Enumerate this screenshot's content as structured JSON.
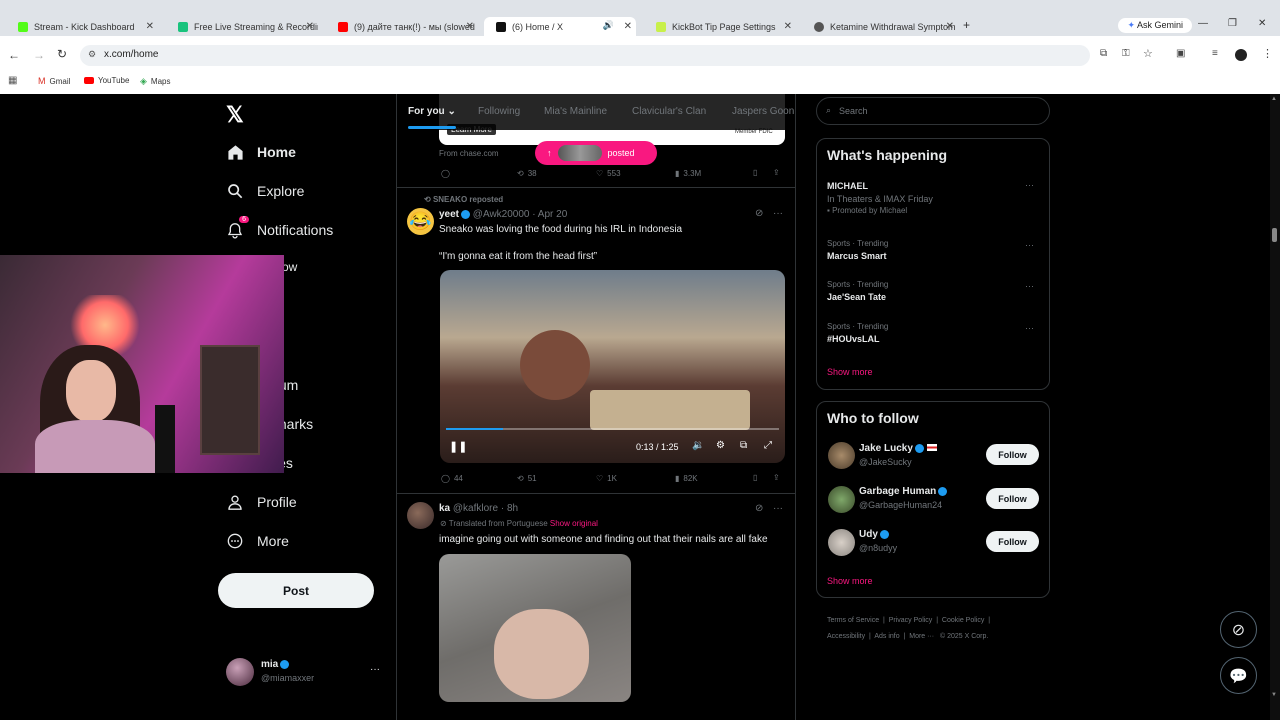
{
  "browser": {
    "tabs": [
      {
        "title": "Stream - Kick Dashboard",
        "color": "#53fc18"
      },
      {
        "title": "Free Live Streaming & Recordin",
        "color": "#19c37d"
      },
      {
        "title": "(9) дайте танк(!) - мы (slowed",
        "color": "#ff0000"
      },
      {
        "title": "(6) Home / X",
        "color": "#111111"
      },
      {
        "title": "KickBot Tip Page Settings",
        "color": "#c8f04a"
      },
      {
        "title": "Ketamine Withdrawal Symptom",
        "color": "#555555"
      }
    ],
    "new_tab": "+",
    "gemini": "Ask Gemini",
    "url": "x.com/home",
    "bookmarks": [
      "Gmail",
      "YouTube",
      "Maps"
    ]
  },
  "nav": {
    "items": [
      {
        "label": "Home",
        "icon": "home-icon"
      },
      {
        "label": "Explore",
        "icon": "search-icon"
      },
      {
        "label": "Notifications",
        "icon": "bell-icon",
        "badge": "6"
      },
      {
        "label": "ow",
        "icon": "follow-icon"
      },
      {
        "label": "nium",
        "icon": "premium-icon"
      },
      {
        "label": "kmarks",
        "icon": "bookmark-icon"
      },
      {
        "label": "cles",
        "icon": "articles-icon"
      },
      {
        "label": "Profile",
        "icon": "person-icon"
      },
      {
        "label": "More",
        "icon": "more-circle-icon"
      }
    ],
    "post": "Post",
    "account": {
      "name": "mia",
      "handle": "@miamaxxer"
    }
  },
  "feed": {
    "tabs": [
      "For you",
      "Following",
      "Mia's Mainline",
      "Clavicular's Clan",
      "Jaspers Goons"
    ],
    "ad": {
      "learn_more": "Learn More",
      "member_fdic": "Member FDIC",
      "source": "From chase.com",
      "stats": {
        "reply": "",
        "retweet": "38",
        "like": "553",
        "views": "3.3M"
      }
    },
    "new_posts": "posted",
    "post1": {
      "repost_by": "SNEAKO reposted",
      "name": "yeet",
      "handle": "@Awk20000",
      "date": "· Apr 20",
      "text1": "Sneako was loving the food during his IRL in Indonesia",
      "text2": "“I'm gonna eat it from the head first”",
      "video_time": "0:13 / 1:25",
      "video_progress": 0.17,
      "stats": {
        "reply": "44",
        "retweet": "51",
        "like": "1K",
        "views": "82K"
      }
    },
    "post2": {
      "name": "ka",
      "handle": "@kafklore",
      "date": "· 8h",
      "translated": "Translated from Portuguese",
      "show_original": "Show original",
      "text": "imagine going out with someone and finding out that their nails are all fake"
    }
  },
  "right": {
    "search_placeholder": "Search",
    "happening": {
      "title": "What's happening",
      "promo": {
        "name": "MICHAEL",
        "desc": "In Theaters & IMAX Friday",
        "promoted": "Promoted by Michael"
      },
      "trends": [
        {
          "category": "Sports · Trending",
          "name": "Marcus Smart"
        },
        {
          "category": "Sports · Trending",
          "name": "Jae'Sean Tate"
        },
        {
          "category": "Sports · Trending",
          "name": "#HOUvsLAL"
        }
      ],
      "show_more": "Show more"
    },
    "who_to_follow": {
      "title": "Who to follow",
      "users": [
        {
          "name": "Jake Lucky",
          "handle": "@JakeSucky"
        },
        {
          "name": "Garbage Human",
          "handle": "@GarbageHuman24"
        },
        {
          "name": "Udy",
          "handle": "@n8udyy"
        }
      ],
      "follow": "Follow",
      "show_more": "Show more"
    },
    "footer": [
      "Terms of Service",
      "Privacy Policy",
      "Cookie Policy",
      "Accessibility",
      "Ads info",
      "More ···",
      "© 2025 X Corp."
    ]
  },
  "colors": {
    "accent": "#1d9bf0",
    "pink": "#f91880",
    "text": "#e7e9ea",
    "muted": "#71767b"
  }
}
